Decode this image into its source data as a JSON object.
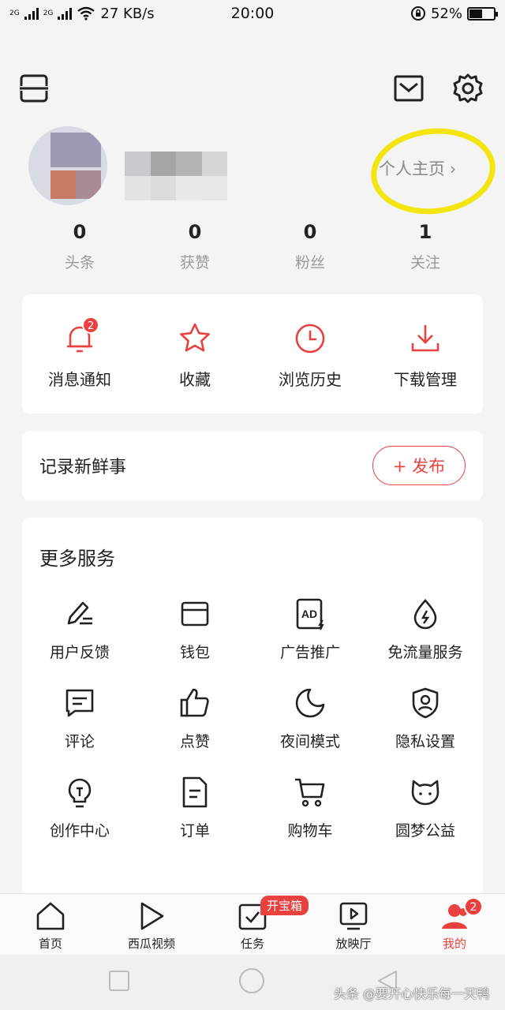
{
  "status_bar": {
    "network_speed": "27 KB/s",
    "time": "20:00",
    "battery": "52%",
    "battery_level": 0.52,
    "sim1": "2G",
    "sim2": "2G"
  },
  "header": {
    "scan_icon": "scan-icon",
    "mail_icon": "mail-icon",
    "settings_icon": "gear-icon"
  },
  "profile": {
    "home_link": "个人主页",
    "home_chevron": "›"
  },
  "stats": [
    {
      "value": "0",
      "label": "头条"
    },
    {
      "value": "0",
      "label": "获赞"
    },
    {
      "value": "0",
      "label": "粉丝"
    },
    {
      "value": "1",
      "label": "关注"
    }
  ],
  "quick_actions": [
    {
      "label": "消息通知",
      "icon": "bell-icon",
      "badge": "2"
    },
    {
      "label": "收藏",
      "icon": "star-icon"
    },
    {
      "label": "浏览历史",
      "icon": "clock-icon"
    },
    {
      "label": "下载管理",
      "icon": "download-icon"
    }
  ],
  "record": {
    "label": "记录新鲜事",
    "publish_button": "+ 发布"
  },
  "services": {
    "title": "更多服务",
    "items": [
      {
        "label": "用户反馈",
        "icon": "pencil-icon"
      },
      {
        "label": "钱包",
        "icon": "wallet-icon"
      },
      {
        "label": "广告推广",
        "icon": "ad-icon"
      },
      {
        "label": "免流量服务",
        "icon": "data-drop-icon"
      },
      {
        "label": "评论",
        "icon": "comment-icon"
      },
      {
        "label": "点赞",
        "icon": "thumbs-up-icon"
      },
      {
        "label": "夜间模式",
        "icon": "moon-icon"
      },
      {
        "label": "隐私设置",
        "icon": "shield-user-icon"
      },
      {
        "label": "创作中心",
        "icon": "lightbulb-icon"
      },
      {
        "label": "订单",
        "icon": "document-icon"
      },
      {
        "label": "购物车",
        "icon": "cart-icon"
      },
      {
        "label": "圆梦公益",
        "icon": "cat-face-icon"
      }
    ],
    "ad_text": "AD"
  },
  "bottom_nav": {
    "tabs": [
      {
        "label": "首页",
        "icon": "home-icon"
      },
      {
        "label": "西瓜视频",
        "icon": "play-icon"
      },
      {
        "label": "任务",
        "icon": "task-icon",
        "tag": "开宝箱"
      },
      {
        "label": "放映厅",
        "icon": "tv-play-icon"
      },
      {
        "label": "我的",
        "icon": "user-icon",
        "badge": "2",
        "active": true
      }
    ]
  },
  "watermark": "头条 @要开心快乐每一天鸭",
  "colors": {
    "accent": "#e8413f",
    "highlight": "#f2e510",
    "background": "#f4f4f4"
  }
}
